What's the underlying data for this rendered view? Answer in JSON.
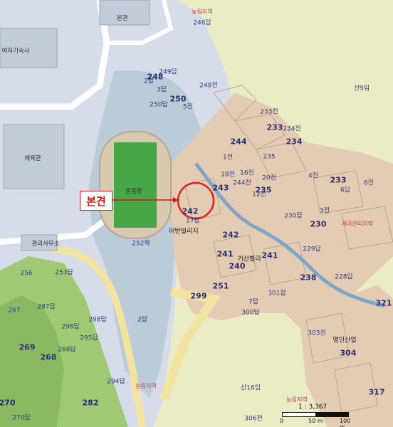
{
  "callout_label": "본견",
  "scale": {
    "ratio": "1 : 3,367",
    "tick0": "0",
    "tick1": "50 m",
    "tick2": "100 m"
  },
  "colors": {
    "background": "#e9ecc4",
    "campus": "#d6dde9",
    "water": "#b8c9d6",
    "parcel": "#e3cbb4",
    "field": "#47a647",
    "forest": "#8fbf66",
    "road": "#f2e3a0",
    "highlight": "#e02020"
  },
  "labels": [
    {
      "text": "본관"
    },
    {
      "text": "농림지역"
    },
    {
      "text": "246답"
    },
    {
      "text": "여자기숙사"
    },
    {
      "text": "249답"
    },
    {
      "text": "248"
    },
    {
      "text": "248전"
    },
    {
      "text": "250"
    },
    {
      "text": "250답"
    },
    {
      "text": "산9임"
    },
    {
      "text": "233전"
    },
    {
      "text": "233"
    },
    {
      "text": "234전"
    },
    {
      "text": "234"
    },
    {
      "text": "244"
    },
    {
      "text": "체육관"
    },
    {
      "text": "235"
    },
    {
      "text": "235"
    },
    {
      "text": "233"
    },
    {
      "text": "243"
    },
    {
      "text": "244전"
    },
    {
      "text": "운동장"
    },
    {
      "text": "242"
    },
    {
      "text": "230"
    },
    {
      "text": "계곡관리지역"
    },
    {
      "text": "230답"
    },
    {
      "text": "어반빌리지"
    },
    {
      "text": "242"
    },
    {
      "text": "관리사무소"
    },
    {
      "text": "252학"
    },
    {
      "text": "241"
    },
    {
      "text": "거산빌리"
    },
    {
      "text": "241"
    },
    {
      "text": "240"
    },
    {
      "text": "229답"
    },
    {
      "text": "238"
    },
    {
      "text": "228답"
    },
    {
      "text": "256"
    },
    {
      "text": "253답"
    },
    {
      "text": "251"
    },
    {
      "text": "299"
    },
    {
      "text": "301잡"
    },
    {
      "text": "321"
    },
    {
      "text": "267"
    },
    {
      "text": "297답"
    },
    {
      "text": "300답"
    },
    {
      "text": "298답"
    },
    {
      "text": "296답"
    },
    {
      "text": "303전"
    },
    {
      "text": "269"
    },
    {
      "text": "268"
    },
    {
      "text": "268답"
    },
    {
      "text": "295답"
    },
    {
      "text": "명인산업"
    },
    {
      "text": "304"
    },
    {
      "text": "294답"
    },
    {
      "text": "산16임"
    },
    {
      "text": "농림지역"
    },
    {
      "text": "317"
    },
    {
      "text": "270"
    },
    {
      "text": "282"
    },
    {
      "text": "농림지역"
    },
    {
      "text": "270답"
    },
    {
      "text": "306전"
    },
    {
      "text": "3답"
    },
    {
      "text": "5전"
    },
    {
      "text": "6전"
    },
    {
      "text": "3전"
    },
    {
      "text": "4전"
    },
    {
      "text": "1전"
    },
    {
      "text": "2답"
    },
    {
      "text": "7답"
    },
    {
      "text": "12전"
    },
    {
      "text": "16전"
    },
    {
      "text": "17답"
    },
    {
      "text": "20전"
    },
    {
      "text": "18전"
    },
    {
      "text": "6답"
    },
    {
      "text": "2답"
    }
  ]
}
